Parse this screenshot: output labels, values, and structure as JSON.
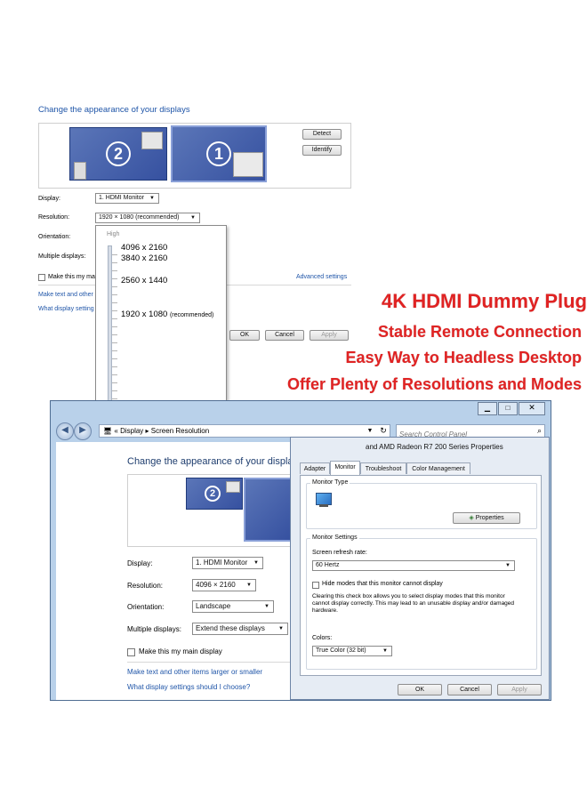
{
  "top_screenshot": {
    "title": "Change the appearance of your displays",
    "detect_label": "Detect",
    "identify_label": "Identify",
    "monitor_2": "2",
    "monitor_1": "1",
    "display_label": "Display:",
    "display_value": "1. HDMI Monitor",
    "resolution_label": "Resolution:",
    "resolution_value": "1920 × 1080 (recommended)",
    "orientation_label": "Orientation:",
    "multiple_label": "Multiple displays:",
    "main_display_label": "Make this my ma",
    "advanced_link": "Advanced settings",
    "make_text_link": "Make text and other",
    "what_settings_link": "What display setting",
    "ok_label": "OK",
    "cancel_label": "Cancel",
    "apply_label": "Apply",
    "dropdown": {
      "high_label": "High",
      "options": [
        "4096 x 2160",
        "3840 x 2160",
        "2560 x 1440",
        "1920 x 1080"
      ],
      "recommended_suffix": "(recommended)"
    }
  },
  "promo": {
    "headline": "4K HDMI Dummy Plug",
    "line1": "Stable Remote Connection",
    "line2": "Easy Way to Headless Desktop",
    "line3": "Offer Plenty of Resolutions and Modes"
  },
  "bottom_window": {
    "breadcrumb_root": "Display",
    "breadcrumb_current": "Screen Resolution",
    "search_placeholder": "Search Control Panel",
    "title": "Change the appearance of your displa",
    "monitor_2": "2",
    "display_label": "Display:",
    "display_value": "1. HDMI Monitor",
    "resolution_label": "Resolution:",
    "resolution_value": "4096 × 2160",
    "orientation_label": "Orientation:",
    "orientation_value": "Landscape",
    "multiple_label": "Multiple displays:",
    "multiple_value": "Extend these displays",
    "main_display_label": "Make this my main display",
    "make_text_link": "Make text and other items larger or smaller",
    "what_settings_link": "What display settings should I choose?"
  },
  "properties_dialog": {
    "title": "and AMD Radeon R7 200 Series Properties",
    "tabs": [
      "Adapter",
      "Monitor",
      "Troubleshoot",
      "Color Management"
    ],
    "monitor_type_label": "Monitor Type",
    "properties_button": "Properties",
    "monitor_settings_label": "Monitor Settings",
    "refresh_label": "Screen refresh rate:",
    "refresh_value": "60 Hertz",
    "hide_modes_label": "Hide modes that this monitor cannot display",
    "hide_modes_note": "Clearing this check box allows you to select display modes that this monitor cannot display correctly. This may lead to an unusable display and/or damaged hardware.",
    "colors_label": "Colors:",
    "colors_value": "True Color (32 bit)",
    "ok_label": "OK",
    "cancel_label": "Cancel",
    "apply_label": "Apply"
  },
  "colors": {
    "accent_red": "#e02323",
    "link_blue": "#1f55a8",
    "monitor_blue": "#4a65b0"
  }
}
